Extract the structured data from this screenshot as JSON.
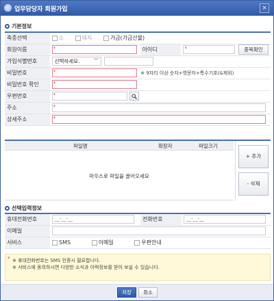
{
  "window": {
    "title": "업무담당자 회원가입",
    "close_glyph": "×"
  },
  "basic": {
    "section_title": "기본정보",
    "type_label": "축종선택",
    "type_options": [
      "소",
      "돼지",
      "가금(가금산물)"
    ],
    "name_label": "회원이름",
    "id_label": "아이디",
    "id_check_button": "중복확인",
    "joinid_label": "가입식별번호",
    "joinid_select": "선택하세요.",
    "pw_label": "비밀번호",
    "pw_hint": "※ 9자리 이상 숫자+영문자+특수기호(&제외)",
    "pw_confirm_label": "비밀번호 확인",
    "zip_label": "우편번호",
    "addr_label": "주소",
    "addr_detail_label": "상세주소",
    "required_mark": "*"
  },
  "files": {
    "headers": {
      "name": "파일명",
      "ext": "확장자",
      "size": "파일크기"
    },
    "drop_message": "마우스로 파일을 끌어오세요",
    "add_button": "+ 추가",
    "delete_button": "- 삭제"
  },
  "optional": {
    "section_title": "선택입력정보",
    "mobile_label": "휴대전화번호",
    "mobile_value": "__-__-__",
    "phone_label": "전화번호",
    "phone_value": "__-__-__",
    "email_label": "이메일",
    "service_label": "서비스",
    "service_options": [
      "SMS",
      "이메일",
      "우편안내"
    ]
  },
  "notice": {
    "lines": [
      "※ 휴대전화번호는 SMS 인증시 필요합니다.",
      "※ 서비스에 동의하시면 다양한 소식과 이력정보를 받아 보실 수 있습니다."
    ]
  },
  "footer": {
    "save_button": "저장",
    "cancel_button": "취소"
  },
  "colors": {
    "titlebar": "#2f5aa6",
    "required_border": "#e07a8a",
    "notice_bg": "#fff9d9",
    "accent": "#4a6ea8"
  }
}
